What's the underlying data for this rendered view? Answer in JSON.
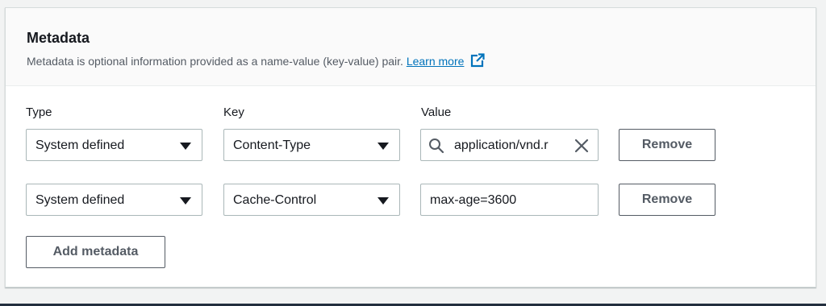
{
  "metadata": {
    "title": "Metadata",
    "description": "Metadata is optional information provided as a name-value (key-value) pair.",
    "learn_more": "Learn more"
  },
  "columns": {
    "type": "Type",
    "key": "Key",
    "value": "Value"
  },
  "rows": [
    {
      "type": "System defined",
      "key": "Content-Type",
      "value": "application/vnd.r",
      "remove_label": "Remove"
    },
    {
      "type": "System defined",
      "key": "Cache-Control",
      "value": "max-age=3600",
      "remove_label": "Remove"
    }
  ],
  "add_button": "Add metadata",
  "icons": {
    "learn_more": "external-link-icon",
    "caret": "caret-down-icon",
    "search": "search-icon",
    "clear": "close-icon"
  },
  "colors": {
    "link": "#0073bb",
    "text": "#16191f",
    "secondary_text": "#545b64",
    "border": "#aab7b8",
    "header_bg": "#fafafa"
  }
}
